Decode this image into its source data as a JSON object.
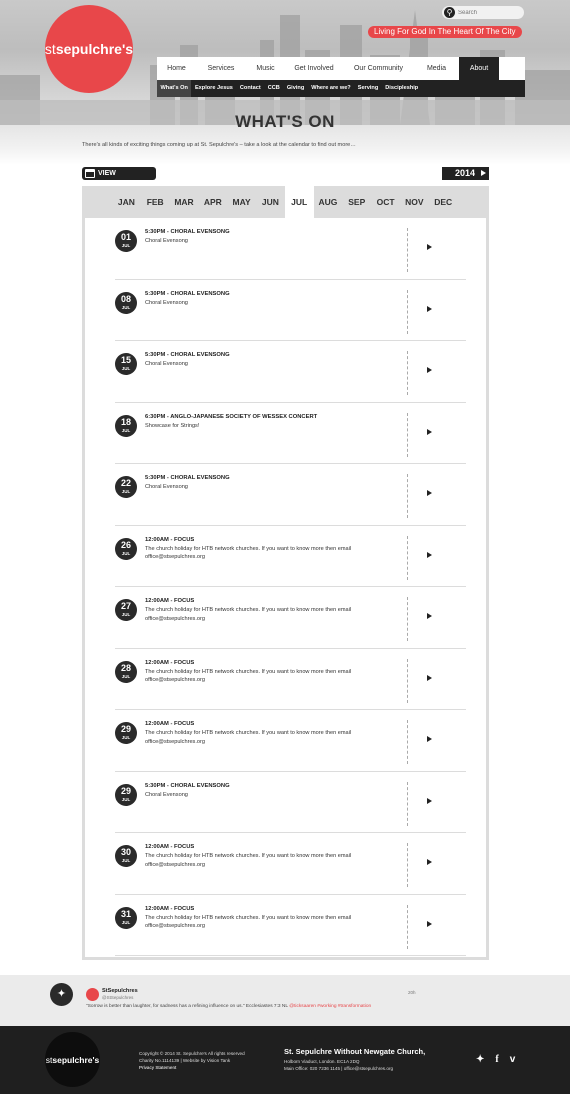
{
  "header": {
    "logo": {
      "prefix": "st",
      "name": "sepulchre's"
    },
    "search_placeholder": "Search",
    "tagline": "Living For God In The Heart Of The City"
  },
  "main_nav": [
    {
      "label": "Home",
      "active": false
    },
    {
      "label": "Services",
      "active": false
    },
    {
      "label": "Music",
      "active": false
    },
    {
      "label": "Get Involved",
      "active": false
    },
    {
      "label": "Our Community",
      "active": false
    },
    {
      "label": "Media",
      "active": false
    },
    {
      "label": "About",
      "active": true
    }
  ],
  "sub_nav": [
    {
      "label": "What's On",
      "active": true
    },
    {
      "label": "Explore Jesus",
      "active": false
    },
    {
      "label": "Contact",
      "active": false
    },
    {
      "label": "CCB",
      "active": false
    },
    {
      "label": "Giving",
      "active": false
    },
    {
      "label": "Where are we?",
      "active": false
    },
    {
      "label": "Serving",
      "active": false
    },
    {
      "label": "Discipleship",
      "active": false
    }
  ],
  "page": {
    "title": "WHAT'S ON",
    "intro": "There's all kinds of exciting things coming up at St. Sepulchre's – take a look at the calendar to find out more…"
  },
  "calendar": {
    "view_label": "VIEW CALENDAR",
    "year": "2014",
    "months": [
      "JAN",
      "FEB",
      "MAR",
      "APR",
      "MAY",
      "JUN",
      "JUL",
      "AUG",
      "SEP",
      "OCT",
      "NOV",
      "DEC"
    ],
    "active_month": "JUL"
  },
  "events": [
    {
      "day": "01",
      "month": "JUL",
      "title": "5:30PM - CHORAL EVENSONG",
      "desc": "Choral Evensong"
    },
    {
      "day": "08",
      "month": "JUL",
      "title": "5:30PM - CHORAL EVENSONG",
      "desc": "Choral Evensong"
    },
    {
      "day": "15",
      "month": "JUL",
      "title": "5:30PM - CHORAL EVENSONG",
      "desc": "Choral Evensong"
    },
    {
      "day": "18",
      "month": "JUL",
      "title": "6:30PM - ANGLO-JAPANESE SOCIETY OF WESSEX CONCERT",
      "desc": "Showcase for Strings!"
    },
    {
      "day": "22",
      "month": "JUL",
      "title": "5:30PM - CHORAL EVENSONG",
      "desc": "Choral Evensong"
    },
    {
      "day": "26",
      "month": "JUL",
      "title": "12:00AM - FOCUS",
      "desc": "The church holiday for HTB network churches. If you want to know more then email office@stsepulchres.org"
    },
    {
      "day": "27",
      "month": "JUL",
      "title": "12:00AM - FOCUS",
      "desc": "The church holiday for HTB network churches. If you want to know more then email office@stsepulchres.org"
    },
    {
      "day": "28",
      "month": "JUL",
      "title": "12:00AM - FOCUS",
      "desc": "The church holiday for HTB network churches. If you want to know more then email office@stsepulchres.org"
    },
    {
      "day": "29",
      "month": "JUL",
      "title": "12:00AM - FOCUS",
      "desc": "The church holiday for HTB network churches. If you want to know more then email office@stsepulchres.org"
    },
    {
      "day": "29",
      "month": "JUL",
      "title": "5:30PM - CHORAL EVENSONG",
      "desc": "Choral Evensong"
    },
    {
      "day": "30",
      "month": "JUL",
      "title": "12:00AM - FOCUS",
      "desc": "The church holiday for HTB network churches. If you want to know more then email office@stsepulchres.org"
    },
    {
      "day": "31",
      "month": "JUL",
      "title": "12:00AM - FOCUS",
      "desc": "The church holiday for HTB network churches. If you want to know more then email office@stsepulchres.org"
    }
  ],
  "tweet": {
    "name": "StSepulchres",
    "handle": "@StSepulchres",
    "time": "20h",
    "text": "\"Sorrow is better than laughter, for sadness has a refining influence on us.\" Ecclesiastes 7:3 NL",
    "tags": "@ticksaaren #working #transformation"
  },
  "footer": {
    "logo": {
      "prefix": "st",
      "name": "sepulchre's"
    },
    "copyright": "Copyright © 2014 St. Sepulchre's All rights reserved",
    "charity": "Charity No.1114139 | Website by Vision Tank",
    "privacy": "Privacy Statement",
    "church_name": "St. Sepulchre Without Newgate Church,",
    "address": "Holborn Viaduct, London. EC1A 2DQ",
    "contact": "Main Office: 020 7236 1145 | office@stsepulchres.org",
    "social": [
      "twitter-icon",
      "facebook-icon",
      "vimeo-icon"
    ]
  },
  "colors": {
    "accent": "#e8474a",
    "dark": "#222222",
    "footer": "#1f1f1f"
  }
}
